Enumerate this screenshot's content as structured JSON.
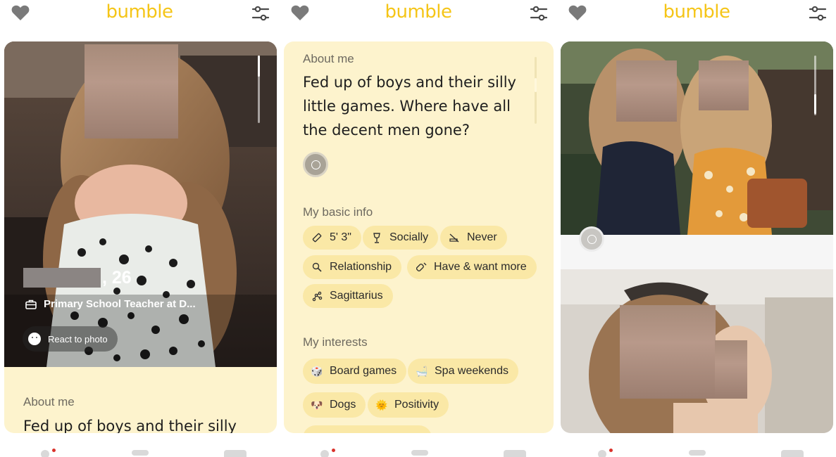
{
  "brand": {
    "logo_text": "bumble",
    "accent": "#f5c518",
    "card_bg": "#fdf3cd",
    "chip_bg": "#fae8a6"
  },
  "panel1": {
    "name_suffix": ", 26",
    "job": "Primary School Teacher at D...",
    "react_to_photo": "React to photo",
    "about_label": "About me",
    "about_preview": "Fed up of boys and their silly"
  },
  "panel2": {
    "about_label": "About me",
    "about_lines": [
      "Fed up of boys and their silly",
      "little games. Where have all",
      "the decent men gone?"
    ],
    "basic_info_label": "My basic info",
    "basic_info": [
      {
        "icon": "ruler-icon",
        "label": "5' 3\""
      },
      {
        "icon": "wine-glass-icon",
        "label": "Socially"
      },
      {
        "icon": "no-smoking-icon",
        "label": "Never"
      },
      {
        "icon": "search-icon",
        "label": "Relationship"
      },
      {
        "icon": "baby-bottle-icon",
        "label": "Have & want more"
      },
      {
        "icon": "zodiac-icon",
        "label": "Sagittarius"
      }
    ],
    "interests_label": "My interests",
    "interests": [
      {
        "emoji": "🎲",
        "label": "Board games"
      },
      {
        "emoji": "🛁",
        "label": "Spa weekends"
      },
      {
        "emoji": "🐶",
        "label": "Dogs"
      },
      {
        "emoji": "🌞",
        "label": "Positivity"
      }
    ]
  }
}
